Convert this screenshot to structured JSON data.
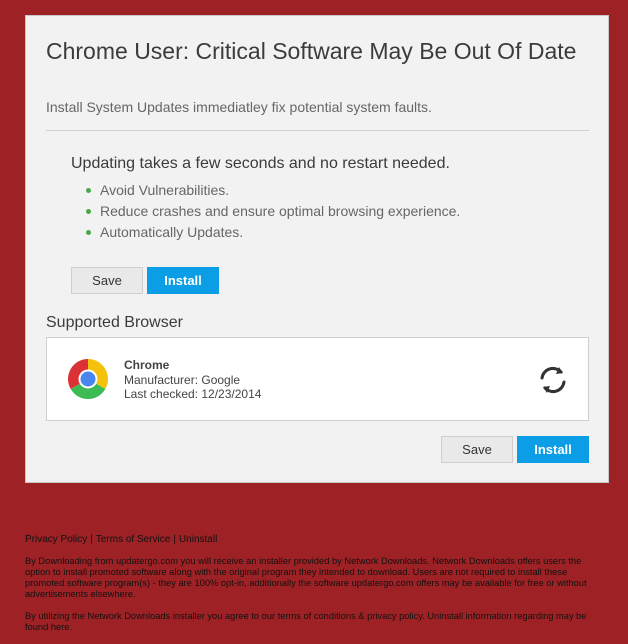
{
  "card": {
    "title": "Chrome User: Critical Software May Be Out Of Date",
    "subtitle": "Install System Updates immediatley fix potential system faults.",
    "intro": "Updating takes a few seconds and no restart needed.",
    "bullets": [
      "Avoid Vulnerabilities.",
      "Reduce crashes and ensure optimal browsing experience.",
      "Automatically Updates."
    ],
    "save_label": "Save",
    "install_label": "Install"
  },
  "supported": {
    "heading": "Supported Browser",
    "browser_name": "Chrome",
    "manufacturer": "Manufacturer: Google",
    "last_checked": "Last checked: 12/23/2014",
    "logo_icon": "chrome-logo",
    "status_icon": "refresh-icon"
  },
  "footer": {
    "privacy_link": "Privacy Policy",
    "terms_link": "Terms of Service",
    "uninstall_link": "Uninstall",
    "separator": "|",
    "disclaimer_1": "By Downloading from updatergo.com you will receive an installer provided by Network Downloads. Network Downloads offers users the option to install promoted software along with the original program they intended to download. Users are not required to install these promoted software program(s) - they are 100% opt-in, additionally the software updatergo.com offers may be available for free or without advertisements elsewhere.",
    "disclaimer_2": "By utilizing the Network Downloads installer you agree to our terms of conditions & privacy policy. Uninstall information regarding may be found here."
  },
  "colors": {
    "page_background": "#9e2225",
    "card_background": "#f2f2f2",
    "install_button": "#0b9ee6",
    "bullet_dot": "#4aa84a"
  }
}
